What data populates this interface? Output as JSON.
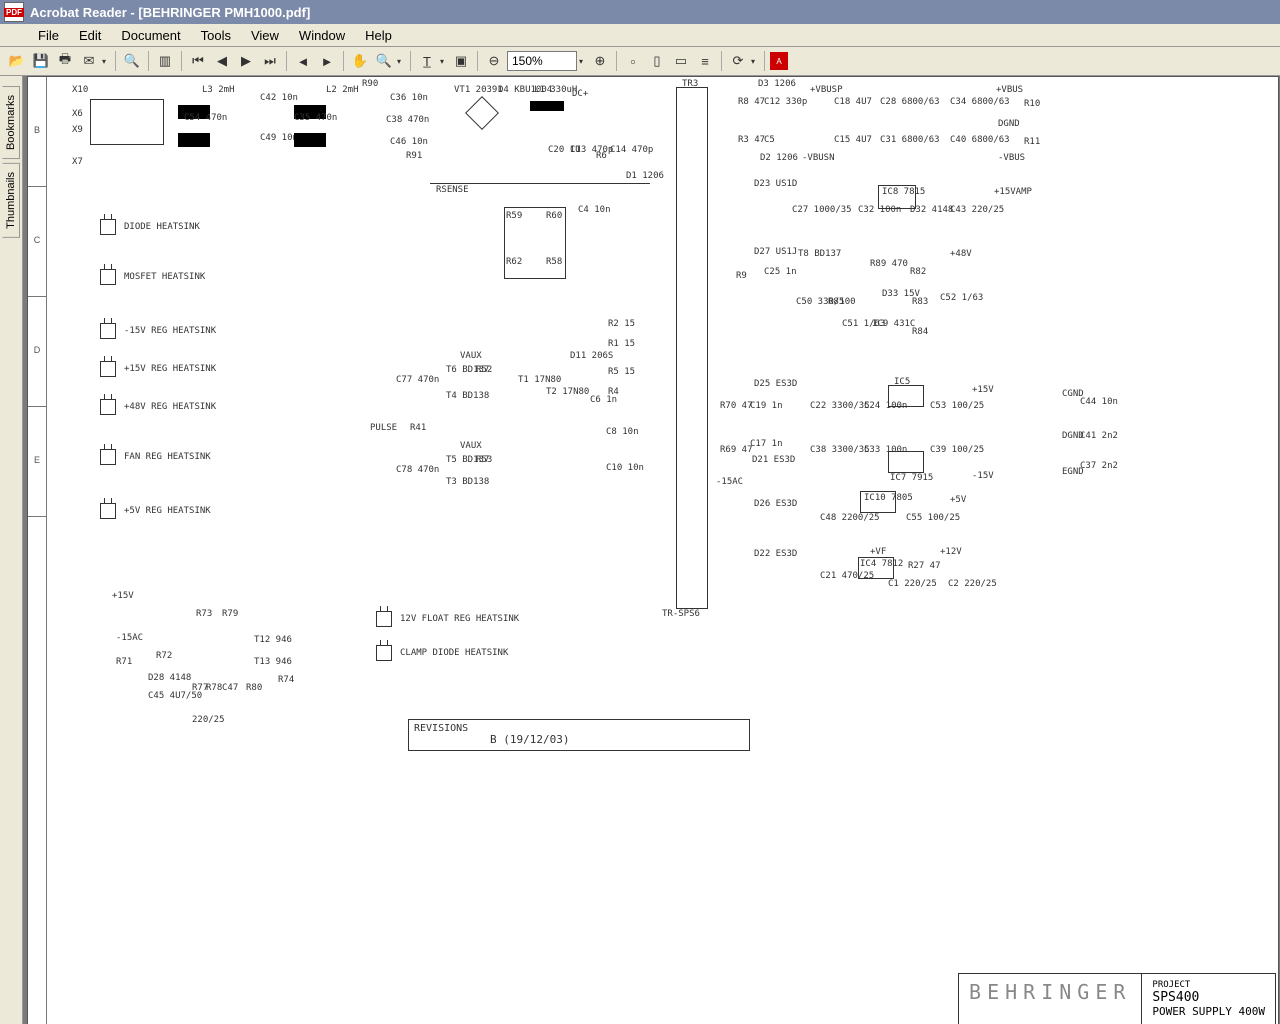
{
  "window": {
    "app": "Acrobat Reader",
    "doc": "[BEHRINGER PMH1000.pdf]"
  },
  "menu": [
    "File",
    "Edit",
    "Document",
    "Tools",
    "View",
    "Window",
    "Help"
  ],
  "zoom": "150%",
  "sidetabs": [
    "Bookmarks",
    "Thumbnails"
  ],
  "ruler": [
    "B",
    "C",
    "D",
    "E"
  ],
  "heatsinks": [
    "DIODE HEATSINK",
    "MOSFET HEATSINK",
    "-15V REG HEATSINK",
    "+15V REG HEATSINK",
    "+48V REG HEATSINK",
    "FAN REG HEATSINK",
    "+5V REG HEATSINK"
  ],
  "heatsinks2": [
    "12V FLOAT REG HEATSINK",
    "CLAMP DIODE HEATSINK"
  ],
  "schem_labels": {
    "x10": "X10",
    "x6": "X6",
    "x9": "X9",
    "x7": "X7",
    "l3": "L3\n2mH",
    "l2": "L2\n2mH",
    "c42": "C42\n10n",
    "c36": "C36\n10n",
    "c54": "C54\n470n",
    "c35": "C35\n470n",
    "c49": "C49\n10n",
    "c38": "C38\n470n",
    "c46": "C46\n10n",
    "r90": "R90",
    "r91": "R91",
    "vt1": "VT1\n20391",
    "d4": "D4\nKBU1004",
    "l1": "L1\n330uH",
    "dcp": "DC+",
    "c20": "C20\n1U",
    "c13": "C13\n470p",
    "r6": "R6",
    "c14": "C14\n470p",
    "rsense": "RSENSE",
    "d1": "D1\n1206",
    "r59": "R59",
    "r60": "R60",
    "r62": "R62",
    "r58": "R58",
    "c4": "C4\n10n",
    "vaux": "VAUX",
    "t6": "T6\nBD137",
    "t4": "T4\nBD138",
    "t5": "T5\nBD137",
    "t3": "T3\nBD138",
    "r52": "R52",
    "r53": "R53",
    "t1": "T1\n17N80",
    "t2": "T2\n17N80",
    "c77": "C77\n470n",
    "c78": "C78\n470n",
    "pulse": "PULSE",
    "r41": "R41",
    "d11": "D11\n206S",
    "r1": "R1\n15",
    "r2": "R2\n15",
    "r5": "R5\n15",
    "r4": "R4",
    "c6": "C6\n1n",
    "c8": "C8\n10n",
    "c10": "C10\n10n",
    "tr3": "TR3",
    "d3": "D3\n1206",
    "vbusp": "+VBUSP",
    "vbus": "+VBUS",
    "r8": "R8\n47",
    "c12": "C12\n330p",
    "c18": "C18\n4U7",
    "c28": "C28\n6800/63",
    "c34": "C34\n6800/63",
    "r10": "R10",
    "dgnd": "DGND",
    "r3": "R3\n47",
    "c5": "C5",
    "d2": "D2\n1206",
    "vbusn": "-VBUSN",
    "vbusm": "-VBUS",
    "c15": "C15\n4U7",
    "c31": "C31\n6800/63",
    "c40": "C40\n6800/63",
    "r11": "R11",
    "d23": "D23\nUS1D",
    "c27": "C27\n1000/35",
    "ic8": "IC8\n7815",
    "c32": "C32\n100n",
    "d32": "D32\n4148",
    "c43": "C43\n220/25",
    "v15amp": "+15VAMP",
    "d27": "D27\nUS1J",
    "t8": "T8\nBD137",
    "r9": "R9",
    "c25": "C25\n1n",
    "r89": "R89\n470",
    "r82": "R82",
    "c50": "C50\n330/100",
    "r85": "R85",
    "d33": "D33\n15V",
    "r83": "R83",
    "c52": "C52\n1/63",
    "c51": "C51\n1/63",
    "ic9": "IC9\n431C",
    "r84": "R84",
    "v48": "+48V",
    "d25": "D25\nES3D",
    "r70": "R70\n47",
    "c19": "C19\n1n",
    "c22": "C22\n3300/35",
    "c24": "C24\n100n",
    "ic5": "IC5",
    "c53": "C53\n100/25",
    "v15p": "+15V",
    "c44": "C44\n10n",
    "r69": "R69\n47",
    "d21": "D21\nES3D",
    "c17": "C17\n1n",
    "c38b": "C38\n3300/35",
    "c33": "C33\n100n",
    "ic7": "IC7\n7915",
    "c39": "C39\n100/25",
    "v15n": "-15V",
    "c41": "C41\n2n2",
    "c37": "C37\n2n2",
    "m15ac": "-15AC",
    "cgnd": "CGND",
    "dgnd2": "DGND",
    "egnd": "EGND",
    "d26": "D26\nES3D",
    "ic10": "IC10\n7805",
    "c48": "C48\n2200/25",
    "c55": "C55\n100/25",
    "v5": "+5V",
    "d22": "D22\nES3D",
    "c21": "C21\n470/25",
    "ic4": "IC4\n7812",
    "r27": "R27\n47",
    "c1": "C1\n220/25",
    "c2": "C2\n220/25",
    "v12": "+12V",
    "vf": "+VF",
    "trsps": "TR-SPS6",
    "p15v": "+15V",
    "m15ac2": "-15AC",
    "r73": "R73",
    "r79": "R79",
    "r71": "R71",
    "r72": "R72",
    "d28": "D28\n4148",
    "t12": "T12\n946",
    "t13": "T13\n946",
    "c45": "C45\n4U7/50",
    "r78": "R78",
    "r77": "R77",
    "c47": "C47",
    "r80": "R80",
    "r74": "R74",
    "v220": "220/25"
  },
  "revisions": {
    "label": "REVISIONS",
    "value": "B (19/12/03)"
  },
  "titleblock": {
    "brand": "BEHRINGER",
    "project_label": "PROJECT",
    "project": "SPS400",
    "desc": "POWER SUPPLY 400W"
  }
}
